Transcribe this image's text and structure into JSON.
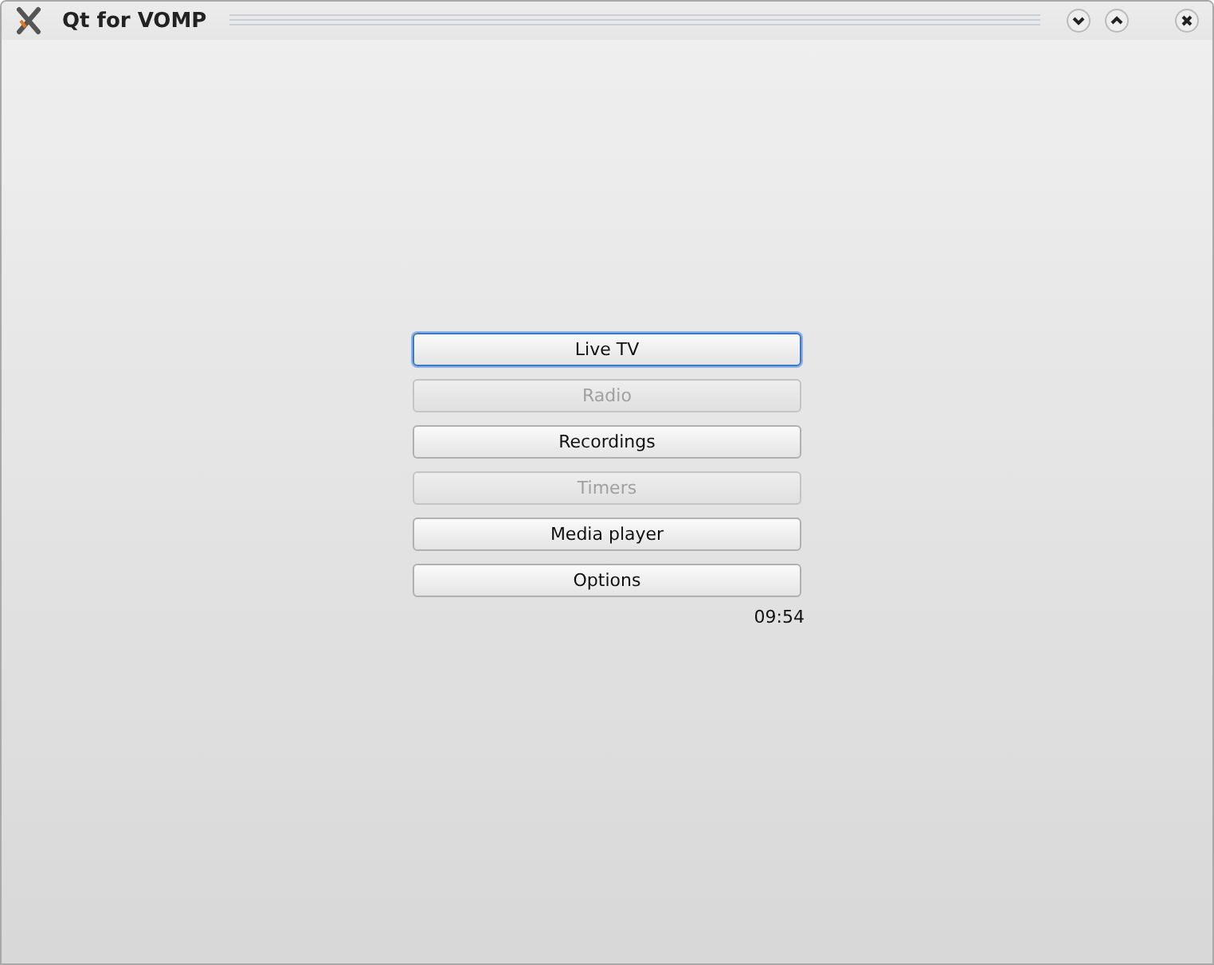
{
  "window": {
    "title": "Qt for VOMP"
  },
  "menu": [
    {
      "label": "Live TV",
      "selected": true,
      "disabled": false
    },
    {
      "label": "Radio",
      "selected": false,
      "disabled": true
    },
    {
      "label": "Recordings",
      "selected": false,
      "disabled": false
    },
    {
      "label": "Timers",
      "selected": false,
      "disabled": true
    },
    {
      "label": "Media player",
      "selected": false,
      "disabled": false
    },
    {
      "label": "Options",
      "selected": false,
      "disabled": false
    }
  ],
  "clock": "09:54"
}
